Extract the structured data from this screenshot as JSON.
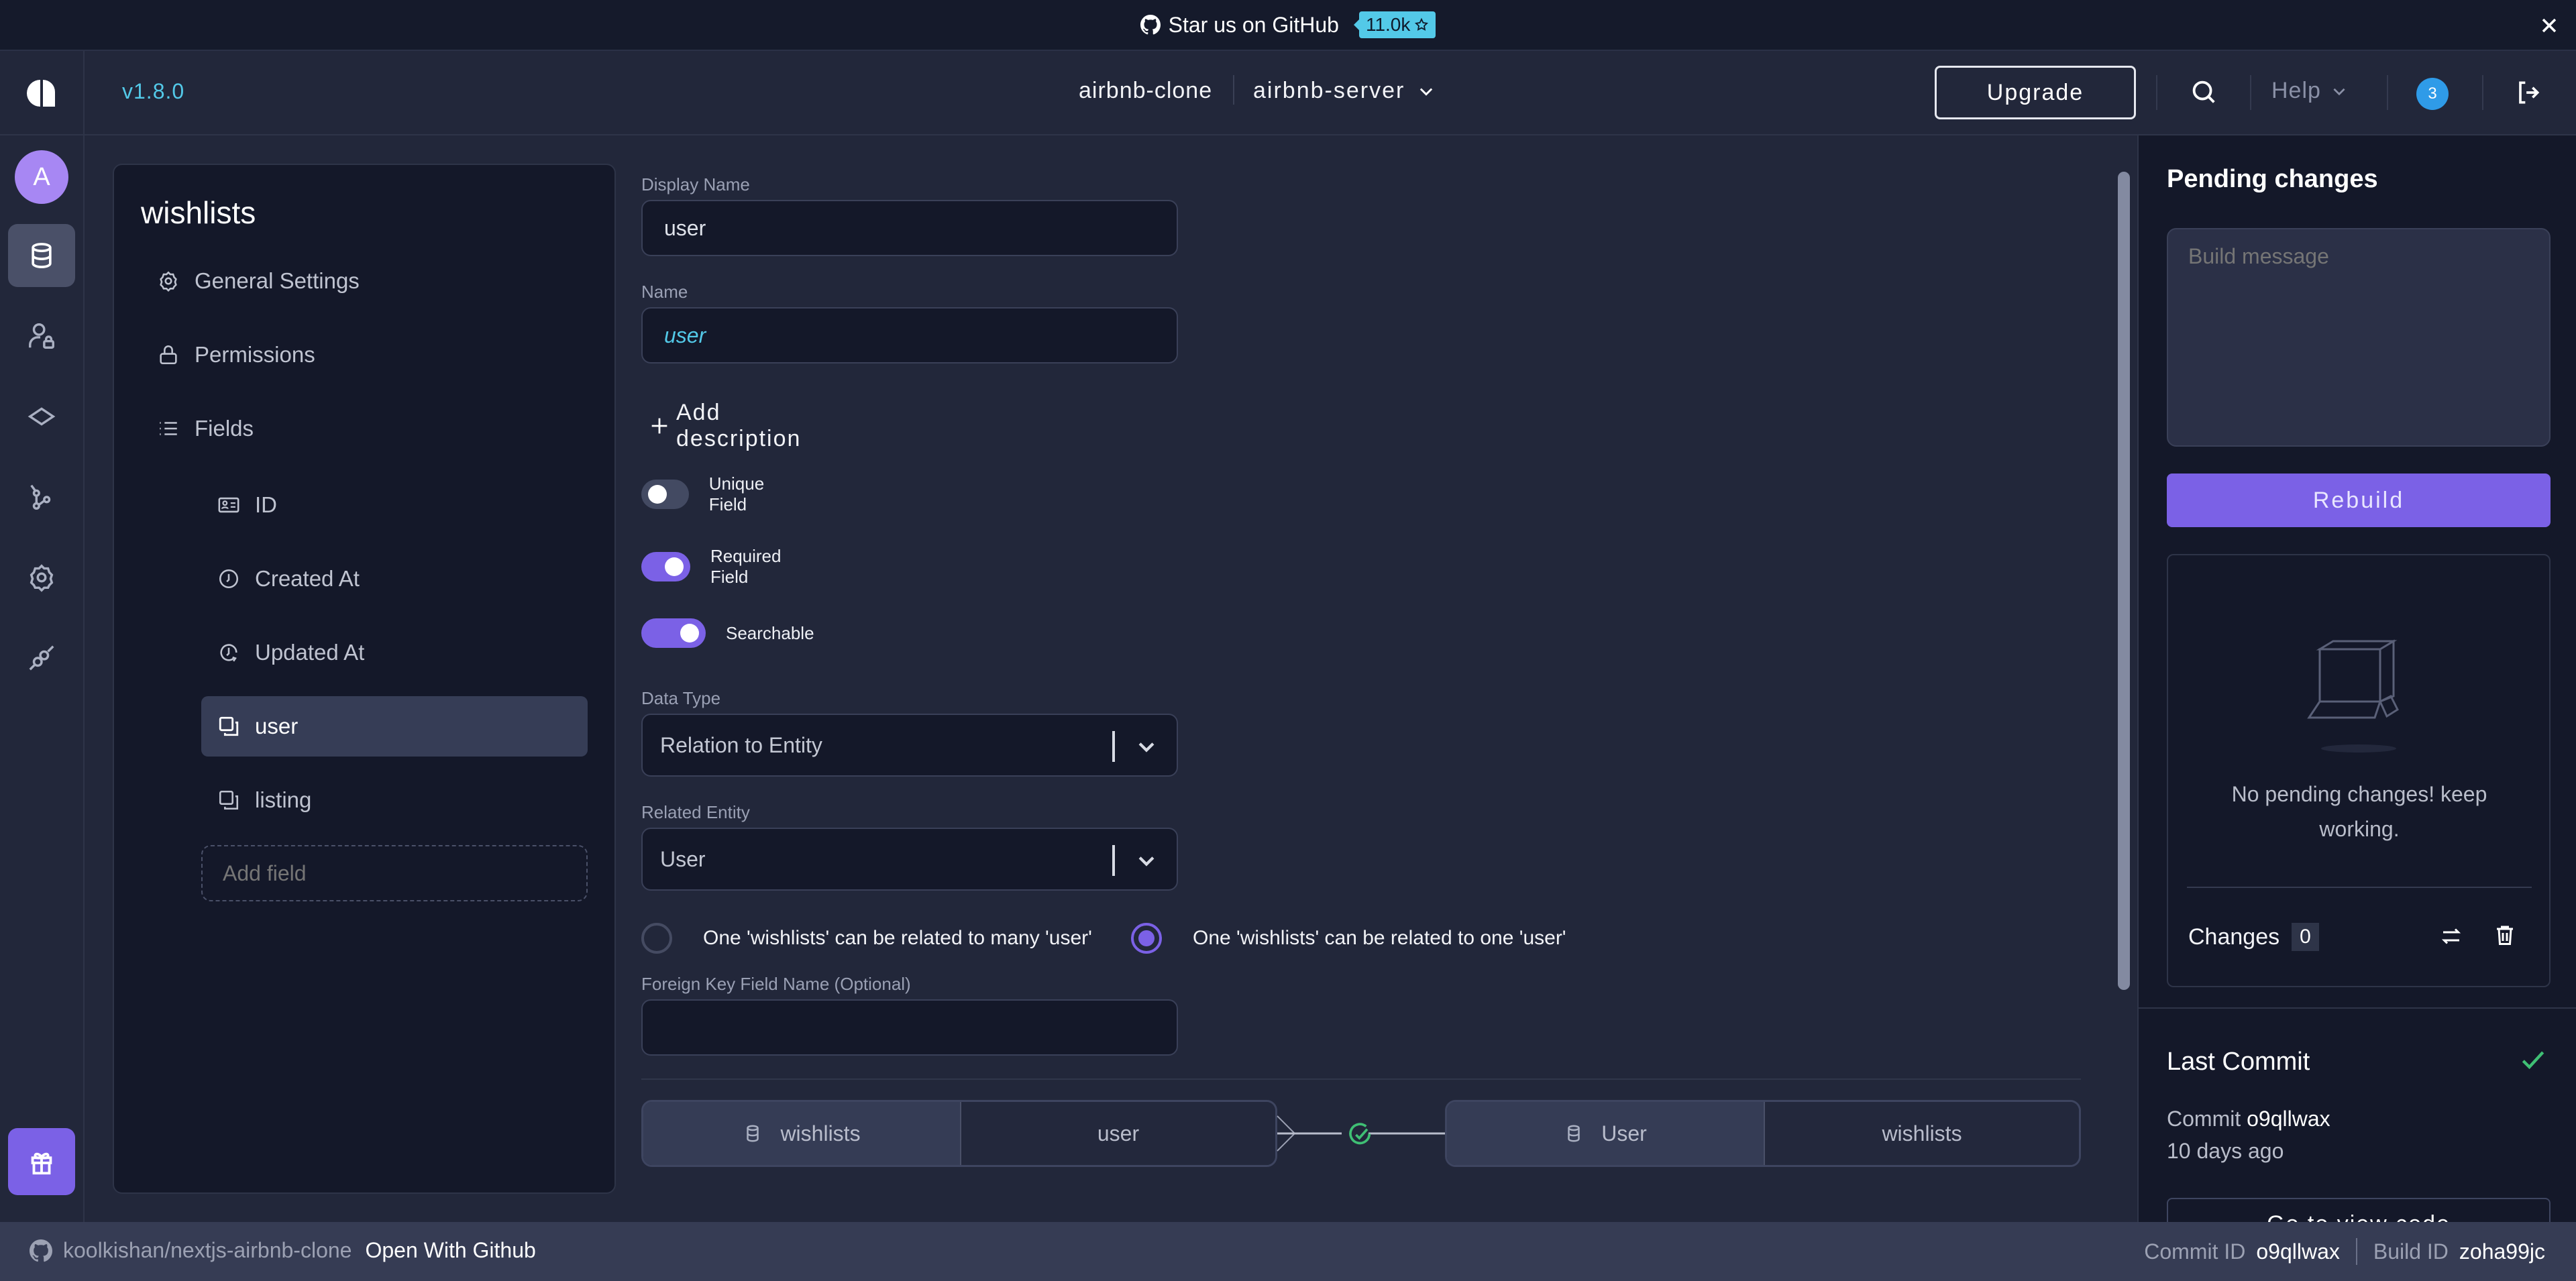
{
  "banner": {
    "text": "Star us on GitHub",
    "stars": "11.0k",
    "icons": {
      "github": "github-icon",
      "star": "star-icon",
      "close": "close-icon"
    }
  },
  "header": {
    "version": "v1.8.0",
    "project": "airbnb-clone",
    "resource": "airbnb-server",
    "upgrade_label": "Upgrade",
    "help_label": "Help",
    "notification_count": "3",
    "icons": {
      "logo": "amplication-logo",
      "search": "search-icon",
      "logout": "logout-icon"
    }
  },
  "rail": {
    "avatar_initial": "A",
    "items": [
      {
        "name": "entities",
        "icon": "database-icon",
        "active": true
      },
      {
        "name": "roles",
        "icon": "user-lock-icon",
        "active": false
      },
      {
        "name": "plugins",
        "icon": "diamond-icon",
        "active": false
      },
      {
        "name": "sync-github",
        "icon": "git-branch-icon",
        "active": false
      },
      {
        "name": "settings",
        "icon": "gear-icon",
        "active": false
      },
      {
        "name": "connections",
        "icon": "plug-icon",
        "active": false
      }
    ],
    "gift_icon": "gift-icon"
  },
  "entity": {
    "title": "wishlists",
    "nav": [
      {
        "label": "General Settings",
        "icon": "settings-icon"
      },
      {
        "label": "Permissions",
        "icon": "lock-icon"
      },
      {
        "label": "Fields",
        "icon": "list-icon"
      }
    ],
    "fields": [
      {
        "label": "ID",
        "icon": "id-card-icon",
        "active": false
      },
      {
        "label": "Created At",
        "icon": "clock-icon",
        "active": false
      },
      {
        "label": "Updated At",
        "icon": "clock-refresh-icon",
        "active": false
      },
      {
        "label": "user",
        "icon": "relation-icon",
        "active": true
      },
      {
        "label": "listing",
        "icon": "relation-icon",
        "active": false
      }
    ],
    "add_field_placeholder": "Add field"
  },
  "form": {
    "display_name_label": "Display Name",
    "display_name_value": "user",
    "name_label": "Name",
    "name_value": "user",
    "add_description": "Add description",
    "toggles": [
      {
        "label": "Unique Field",
        "on": false
      },
      {
        "label": "Required Field",
        "on": true
      },
      {
        "label": "Searchable",
        "on": true
      }
    ],
    "data_type_label": "Data Type",
    "data_type_value": "Relation to Entity",
    "related_entity_label": "Related Entity",
    "related_entity_value": "User",
    "relation_options": [
      {
        "label": "One 'wishlists' can be related to many 'user'",
        "selected": false
      },
      {
        "label": "One 'wishlists' can be related to one 'user'",
        "selected": true
      }
    ],
    "fk_label": "Foreign Key Field Name (Optional)",
    "fk_value": ""
  },
  "relation_diagram": {
    "left": {
      "entity": "wishlists",
      "field": "user"
    },
    "right": {
      "entity": "User",
      "field": "wishlists"
    },
    "status_icon": "check-circle-icon",
    "status_color": "#3fbf74"
  },
  "pending": {
    "title": "Pending changes",
    "build_message_placeholder": "Build message",
    "rebuild_label": "Rebuild",
    "empty_message": "No pending changes! keep working.",
    "changes_label": "Changes",
    "changes_count": "0",
    "icons": {
      "compare": "swap-icon",
      "discard": "trash-icon",
      "empty": "empty-box-icon"
    }
  },
  "last_commit": {
    "title": "Last Commit",
    "commit_prefix": "Commit",
    "commit_id": "o9qllwax",
    "time_ago": "10 days ago",
    "view_code_label": "Go to view code",
    "status_icon": "check-icon"
  },
  "statusbar": {
    "repo": "koolkishan/nextjs-airbnb-clone",
    "open_github": "Open With Github",
    "commit_label": "Commit ID",
    "commit_id": "o9qllwax",
    "build_label": "Build ID",
    "build_id": "zoha99jc"
  },
  "colors": {
    "accent": "#7b61e6",
    "link": "#53c9e8",
    "notification": "#2f9be8",
    "success": "#3fbf74",
    "background": "#22273a",
    "panel": "#141829"
  }
}
